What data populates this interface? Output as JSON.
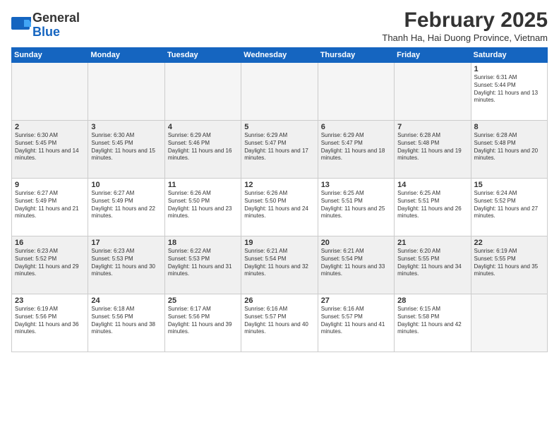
{
  "logo": {
    "text_general": "General",
    "text_blue": "Blue"
  },
  "header": {
    "month_year": "February 2025",
    "location": "Thanh Ha, Hai Duong Province, Vietnam"
  },
  "days_of_week": [
    "Sunday",
    "Monday",
    "Tuesday",
    "Wednesday",
    "Thursday",
    "Friday",
    "Saturday"
  ],
  "weeks": [
    [
      {
        "day": "",
        "empty": true
      },
      {
        "day": "",
        "empty": true
      },
      {
        "day": "",
        "empty": true
      },
      {
        "day": "",
        "empty": true
      },
      {
        "day": "",
        "empty": true
      },
      {
        "day": "",
        "empty": true
      },
      {
        "day": "1",
        "sunrise": "6:31 AM",
        "sunset": "5:44 PM",
        "daylight": "11 hours and 13 minutes."
      }
    ],
    [
      {
        "day": "2",
        "sunrise": "6:30 AM",
        "sunset": "5:45 PM",
        "daylight": "11 hours and 14 minutes."
      },
      {
        "day": "3",
        "sunrise": "6:30 AM",
        "sunset": "5:45 PM",
        "daylight": "11 hours and 15 minutes."
      },
      {
        "day": "4",
        "sunrise": "6:29 AM",
        "sunset": "5:46 PM",
        "daylight": "11 hours and 16 minutes."
      },
      {
        "day": "5",
        "sunrise": "6:29 AM",
        "sunset": "5:47 PM",
        "daylight": "11 hours and 17 minutes."
      },
      {
        "day": "6",
        "sunrise": "6:29 AM",
        "sunset": "5:47 PM",
        "daylight": "11 hours and 18 minutes."
      },
      {
        "day": "7",
        "sunrise": "6:28 AM",
        "sunset": "5:48 PM",
        "daylight": "11 hours and 19 minutes."
      },
      {
        "day": "8",
        "sunrise": "6:28 AM",
        "sunset": "5:48 PM",
        "daylight": "11 hours and 20 minutes."
      }
    ],
    [
      {
        "day": "9",
        "sunrise": "6:27 AM",
        "sunset": "5:49 PM",
        "daylight": "11 hours and 21 minutes."
      },
      {
        "day": "10",
        "sunrise": "6:27 AM",
        "sunset": "5:49 PM",
        "daylight": "11 hours and 22 minutes."
      },
      {
        "day": "11",
        "sunrise": "6:26 AM",
        "sunset": "5:50 PM",
        "daylight": "11 hours and 23 minutes."
      },
      {
        "day": "12",
        "sunrise": "6:26 AM",
        "sunset": "5:50 PM",
        "daylight": "11 hours and 24 minutes."
      },
      {
        "day": "13",
        "sunrise": "6:25 AM",
        "sunset": "5:51 PM",
        "daylight": "11 hours and 25 minutes."
      },
      {
        "day": "14",
        "sunrise": "6:25 AM",
        "sunset": "5:51 PM",
        "daylight": "11 hours and 26 minutes."
      },
      {
        "day": "15",
        "sunrise": "6:24 AM",
        "sunset": "5:52 PM",
        "daylight": "11 hours and 27 minutes."
      }
    ],
    [
      {
        "day": "16",
        "sunrise": "6:23 AM",
        "sunset": "5:52 PM",
        "daylight": "11 hours and 29 minutes."
      },
      {
        "day": "17",
        "sunrise": "6:23 AM",
        "sunset": "5:53 PM",
        "daylight": "11 hours and 30 minutes."
      },
      {
        "day": "18",
        "sunrise": "6:22 AM",
        "sunset": "5:53 PM",
        "daylight": "11 hours and 31 minutes."
      },
      {
        "day": "19",
        "sunrise": "6:21 AM",
        "sunset": "5:54 PM",
        "daylight": "11 hours and 32 minutes."
      },
      {
        "day": "20",
        "sunrise": "6:21 AM",
        "sunset": "5:54 PM",
        "daylight": "11 hours and 33 minutes."
      },
      {
        "day": "21",
        "sunrise": "6:20 AM",
        "sunset": "5:55 PM",
        "daylight": "11 hours and 34 minutes."
      },
      {
        "day": "22",
        "sunrise": "6:19 AM",
        "sunset": "5:55 PM",
        "daylight": "11 hours and 35 minutes."
      }
    ],
    [
      {
        "day": "23",
        "sunrise": "6:19 AM",
        "sunset": "5:56 PM",
        "daylight": "11 hours and 36 minutes."
      },
      {
        "day": "24",
        "sunrise": "6:18 AM",
        "sunset": "5:56 PM",
        "daylight": "11 hours and 38 minutes."
      },
      {
        "day": "25",
        "sunrise": "6:17 AM",
        "sunset": "5:56 PM",
        "daylight": "11 hours and 39 minutes."
      },
      {
        "day": "26",
        "sunrise": "6:16 AM",
        "sunset": "5:57 PM",
        "daylight": "11 hours and 40 minutes."
      },
      {
        "day": "27",
        "sunrise": "6:16 AM",
        "sunset": "5:57 PM",
        "daylight": "11 hours and 41 minutes."
      },
      {
        "day": "28",
        "sunrise": "6:15 AM",
        "sunset": "5:58 PM",
        "daylight": "11 hours and 42 minutes."
      },
      {
        "day": "",
        "empty": true
      }
    ]
  ]
}
